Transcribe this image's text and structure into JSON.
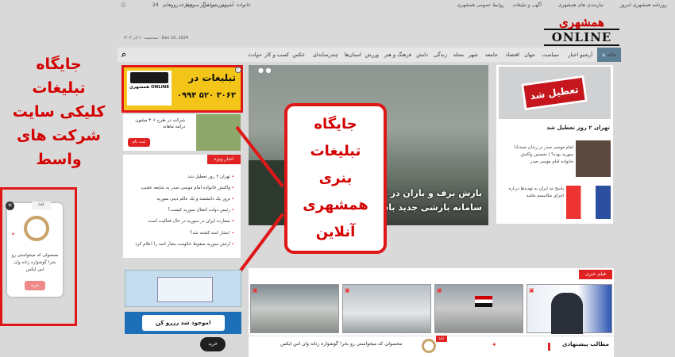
{
  "topbar": {
    "right_links": [
      "روزنامه همشهری امروز",
      "نیازمندی های همشهری",
      "آگهی و تبلیغات",
      "روابط عمومی همشهری"
    ],
    "left_links": [
      "سرخط",
      "تماشاگر",
      "آشپزی",
      "خانواده",
      "سرزمین من",
      "دوچرخه",
      "24",
      "رووهانم"
    ]
  },
  "logo": {
    "line1": "همشهری",
    "line2": "ONLINE"
  },
  "date_text": "سه‌شنبه ۲۰ آذر ۱۴۰۳ - Dec 10, 2024",
  "nav": {
    "home": "خانه",
    "items": [
      "آرشیو اخبار",
      "سیاست",
      "جهان",
      "اقتصاد",
      "جامعه",
      "شهر",
      "محله",
      "زندگی",
      "دانش",
      "فرهنگ و هنر",
      "ورزش",
      "استان‌ها",
      "چندرسانه‌ای",
      "عکس",
      "کسب و کار",
      "حوادث"
    ]
  },
  "annotations": {
    "left_callout": [
      "جایگاه",
      "تبلیغات",
      "کلیکی سایت",
      "شرکت های",
      "واسط"
    ],
    "center_callout": [
      "جایگاه",
      "تبلیغات",
      "بنری",
      "همشهری",
      "آنلاین"
    ]
  },
  "ad_banner": {
    "title": "تبلیغات در",
    "phone": "۰۹۹۴ ۵۲۰ ۳۰۶۳",
    "logo_text": "همشهری ONLINE"
  },
  "ad_small": {
    "text": "شرکت در طرح ۳۰۶ میلیون درآمد ماهانه",
    "button": "ثبت نام"
  },
  "hero": {
    "headline_line1": "بارش برف و باران در ۵ استان",
    "headline_line2": "سامانه بارشی جدید باشید"
  },
  "closed_box": {
    "sign": "تعطیل شد",
    "caption": "تهران ۲ روز تعطیل شد"
  },
  "side_news": [
    {
      "text": "امام موسی صدر در زندان صیدنایا",
      "text2": "سوریه بوده؟ | نخستین واکنش",
      "text3": "خانواده امام موسی صدر"
    },
    {
      "text": "پاسخ تند ایران به تهدیدها درباره",
      "text2": "اجرای مکانیسم ماشه"
    }
  ],
  "special_news": {
    "title": "اخبار ویژه",
    "items": [
      "تهران ۲ روز تعطیل شد",
      "واکنش خانواده امام موسی صدر به شایعه عجیب",
      "ترور یک دانشمند و یک عالم دینی سوریه",
      "رئیس دولت انتقال سوریه کیست؟",
      "سفارت ایران در سوریه در حال فعالیت است",
      "بشار اسد کشته شد؟!",
      "ارتش سوریه سقوط حکومت بشار اسد را اعلام کرد"
    ]
  },
  "film_news": {
    "title": "فیلم خبری"
  },
  "reservation": {
    "text": "موجود شد رزرو کن!"
  },
  "popup_ad": {
    "brand": "کاما",
    "text": "محصولی که میخواستی رو بخر! گوشواره زنانه وان اس ایکس",
    "button": "خرید"
  },
  "bottom_bar": {
    "text": "محصولی که میخواستی رو بخر! گوشواره زنانه وان اس ایکس",
    "badge": "کاما",
    "button": "خرید",
    "suggested": "مطالب پیشنهادی"
  }
}
